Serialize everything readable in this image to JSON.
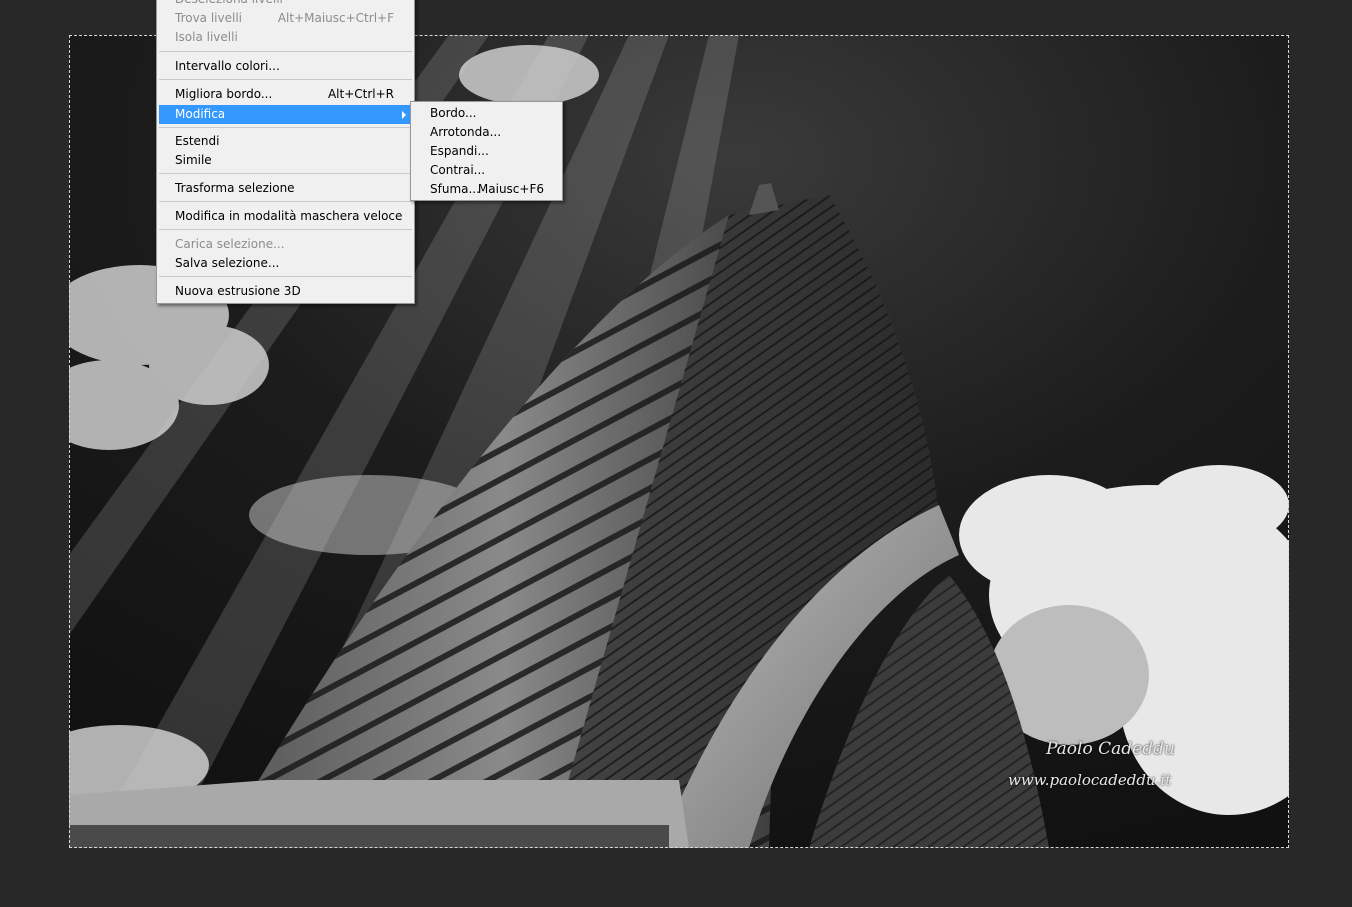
{
  "watermark": {
    "name": "Paolo Cadeddu",
    "site": "www.paolocadeddu.it"
  },
  "main_menu": {
    "items": [
      {
        "label": "Deseleziona livelli",
        "shortcut": "",
        "disabled": true
      },
      {
        "label": "Trova livelli",
        "shortcut": "Alt+Maiusc+Ctrl+F",
        "disabled": true
      },
      {
        "label": "Isola livelli",
        "shortcut": "",
        "disabled": true
      },
      {
        "label": "Intervallo colori...",
        "shortcut": ""
      },
      {
        "label": "Migliora bordo...",
        "shortcut": "Alt+Ctrl+R"
      },
      {
        "label": "Modifica",
        "shortcut": "",
        "highlighted": true,
        "submenu": true
      },
      {
        "label": "Estendi",
        "shortcut": ""
      },
      {
        "label": "Simile",
        "shortcut": ""
      },
      {
        "label": "Trasforma selezione",
        "shortcut": ""
      },
      {
        "label": "Modifica in modalità maschera veloce",
        "shortcut": ""
      },
      {
        "label": "Carica selezione...",
        "shortcut": "",
        "disabled": true
      },
      {
        "label": "Salva selezione...",
        "shortcut": ""
      },
      {
        "label": "Nuova estrusione 3D",
        "shortcut": ""
      }
    ]
  },
  "sub_menu": {
    "items": [
      {
        "label": "Bordo...",
        "shortcut": ""
      },
      {
        "label": "Arrotonda...",
        "shortcut": ""
      },
      {
        "label": "Espandi...",
        "shortcut": ""
      },
      {
        "label": "Contrai...",
        "shortcut": ""
      },
      {
        "label": "Sfuma...",
        "shortcut": "Maiusc+F6"
      }
    ]
  },
  "colors": {
    "workspace": "#282828",
    "menu_bg": "#f0f0f0",
    "highlight": "#3399ff",
    "disabled_text": "#8c8c8c"
  }
}
